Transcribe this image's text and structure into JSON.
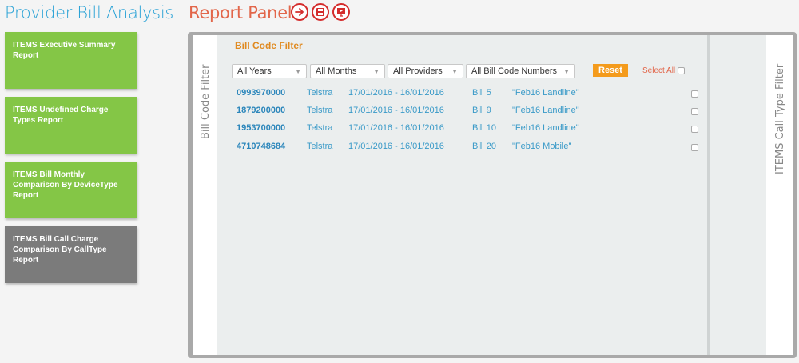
{
  "header": {
    "app_title": "Provider Bill Analysis",
    "panel_title": "Report Panel",
    "toolbar_icons": [
      "arrow-right-icon",
      "save-icon",
      "presentation-icon"
    ]
  },
  "reports": [
    {
      "label": "ITEMS Executive Summary Report",
      "active": false
    },
    {
      "label": "ITEMS Undefined Charge Types Report",
      "active": false
    },
    {
      "label": "ITEMS Bill Monthly Comparison By DeviceType Report",
      "active": false
    },
    {
      "label": "ITEMS Bill Call Charge Comparison By CallType Report",
      "active": true
    }
  ],
  "panel": {
    "left_tab": "Bill Code Filter",
    "right_tab": "ITEMS Call Type Filter",
    "filter_heading": "Bill Code Filter",
    "filters": {
      "years": "All Years",
      "months": "All Months",
      "providers": "All Providers",
      "bill_codes": "All Bill Code Numbers"
    },
    "reset_label": "Reset",
    "select_all_label": "Select All",
    "rows": [
      {
        "number": "0993970000",
        "provider": "Telstra",
        "period": "17/01/2016 - 16/01/2016",
        "bill": "Bill 5",
        "desc": "\"Feb16 Landline\""
      },
      {
        "number": "1879200000",
        "provider": "Telstra",
        "period": "17/01/2016 - 16/01/2016",
        "bill": "Bill 9",
        "desc": "\"Feb16 Landline\""
      },
      {
        "number": "1953700000",
        "provider": "Telstra",
        "period": "17/01/2016 - 16/01/2016",
        "bill": "Bill 10",
        "desc": "\"Feb16 Landline\""
      },
      {
        "number": "4710748684",
        "provider": "Telstra",
        "period": "17/01/2016 - 16/01/2016",
        "bill": "Bill 20",
        "desc": "\"Feb16 Mobile\""
      }
    ]
  }
}
